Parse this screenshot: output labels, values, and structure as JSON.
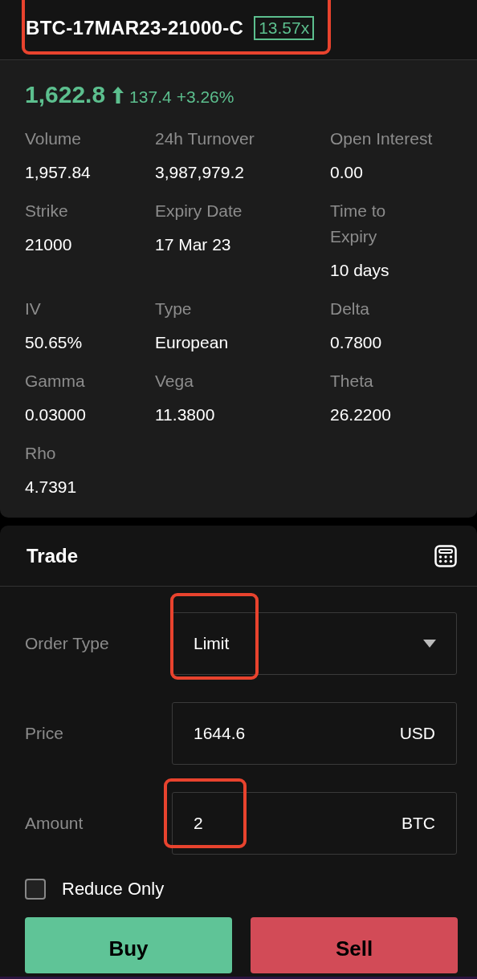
{
  "header": {
    "symbol": "BTC-17MAR23-21000-C",
    "leverage": "13.57x",
    "highlighted": true
  },
  "price": {
    "last": "1,622.8",
    "change": "137.4",
    "change_percent": "+3.26%"
  },
  "stats": [
    {
      "label": "Volume",
      "value": "1,957.84"
    },
    {
      "label": "24h Turnover",
      "value": "3,987,979.2"
    },
    {
      "label": "Open Interest",
      "value": "0.00"
    },
    {
      "label": "Strike",
      "value": "21000"
    },
    {
      "label": "Expiry Date",
      "value": "17 Mar 23"
    },
    {
      "label": "Time to Expiry",
      "value": "10 days"
    },
    {
      "label": "IV",
      "value": "50.65%"
    },
    {
      "label": "Type",
      "value": "European"
    },
    {
      "label": "Delta",
      "value": "0.7800"
    },
    {
      "label": "Gamma",
      "value": "0.03000"
    },
    {
      "label": "Vega",
      "value": "11.3800"
    },
    {
      "label": "Theta",
      "value": "26.2200"
    },
    {
      "label": "Rho",
      "value": "4.7391"
    }
  ],
  "trade": {
    "title": "Trade",
    "fields": [
      {
        "kind": "select",
        "label": "Order Type",
        "value": "Limit",
        "highlighted": true
      },
      {
        "kind": "input",
        "label": "Price",
        "value": "1644.6",
        "unit": "USD"
      },
      {
        "kind": "input",
        "label": "Amount",
        "value": "2",
        "unit": "BTC",
        "highlighted": true
      }
    ],
    "reduce_only": {
      "label": "Reduce Only",
      "checked": false
    },
    "buttons": [
      {
        "kind": "buy",
        "label": "Buy"
      },
      {
        "kind": "sell",
        "label": "Sell"
      }
    ]
  }
}
